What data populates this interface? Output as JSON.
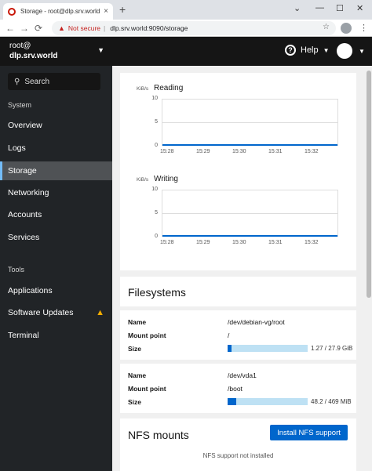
{
  "browser": {
    "tab_title": "Storage - root@dlp.srv.world",
    "new_tab": "+",
    "close_tab": "×",
    "not_secure": "Not secure",
    "url": "dlp.srv.world:9090/storage"
  },
  "header": {
    "user": "root@",
    "host": "dlp.srv.world",
    "help_label": "Help"
  },
  "sidebar": {
    "search_placeholder": "Search",
    "system_section": "System",
    "items": [
      {
        "label": "Overview"
      },
      {
        "label": "Logs"
      },
      {
        "label": "Storage"
      },
      {
        "label": "Networking"
      },
      {
        "label": "Accounts"
      },
      {
        "label": "Services"
      }
    ],
    "tools_section": "Tools",
    "tools": [
      {
        "label": "Applications"
      },
      {
        "label": "Software Updates"
      },
      {
        "label": "Terminal"
      }
    ],
    "active": "Storage"
  },
  "charts": [
    {
      "title": "Reading",
      "unit": "KiB/s"
    },
    {
      "title": "Writing",
      "unit": "KiB/s"
    }
  ],
  "chart_data": [
    {
      "type": "line",
      "title": "Reading",
      "ylabel": "KiB/s",
      "x": [
        "15:28",
        "15:29",
        "15:30",
        "15:31",
        "15:32"
      ],
      "yticks": [
        "10",
        "5",
        "0"
      ],
      "ylim": [
        0,
        10
      ],
      "series": [
        {
          "values": [
            0,
            0,
            0,
            0,
            0
          ]
        }
      ],
      "color": "#0066cc"
    },
    {
      "type": "line",
      "title": "Writing",
      "ylabel": "KiB/s",
      "x": [
        "15:28",
        "15:29",
        "15:30",
        "15:31",
        "15:32"
      ],
      "yticks": [
        "10",
        "5",
        "0"
      ],
      "ylim": [
        0,
        10
      ],
      "series": [
        {
          "values": [
            0,
            0,
            0,
            0,
            0
          ]
        }
      ],
      "color": "#0066cc"
    }
  ],
  "filesystems": {
    "title": "Filesystems",
    "labels": {
      "name": "Name",
      "mount": "Mount point",
      "size": "Size"
    },
    "items": [
      {
        "name": "/dev/debian-vg/root",
        "mount": "/",
        "size": "1.27 / 27.9 GiB",
        "fraction": 0.046
      },
      {
        "name": "/dev/vda1",
        "mount": "/boot",
        "size": "48.2 / 469 MiB",
        "fraction": 0.103
      }
    ]
  },
  "nfs": {
    "title": "NFS mounts",
    "button": "Install NFS support",
    "status": "NFS support not installed"
  }
}
